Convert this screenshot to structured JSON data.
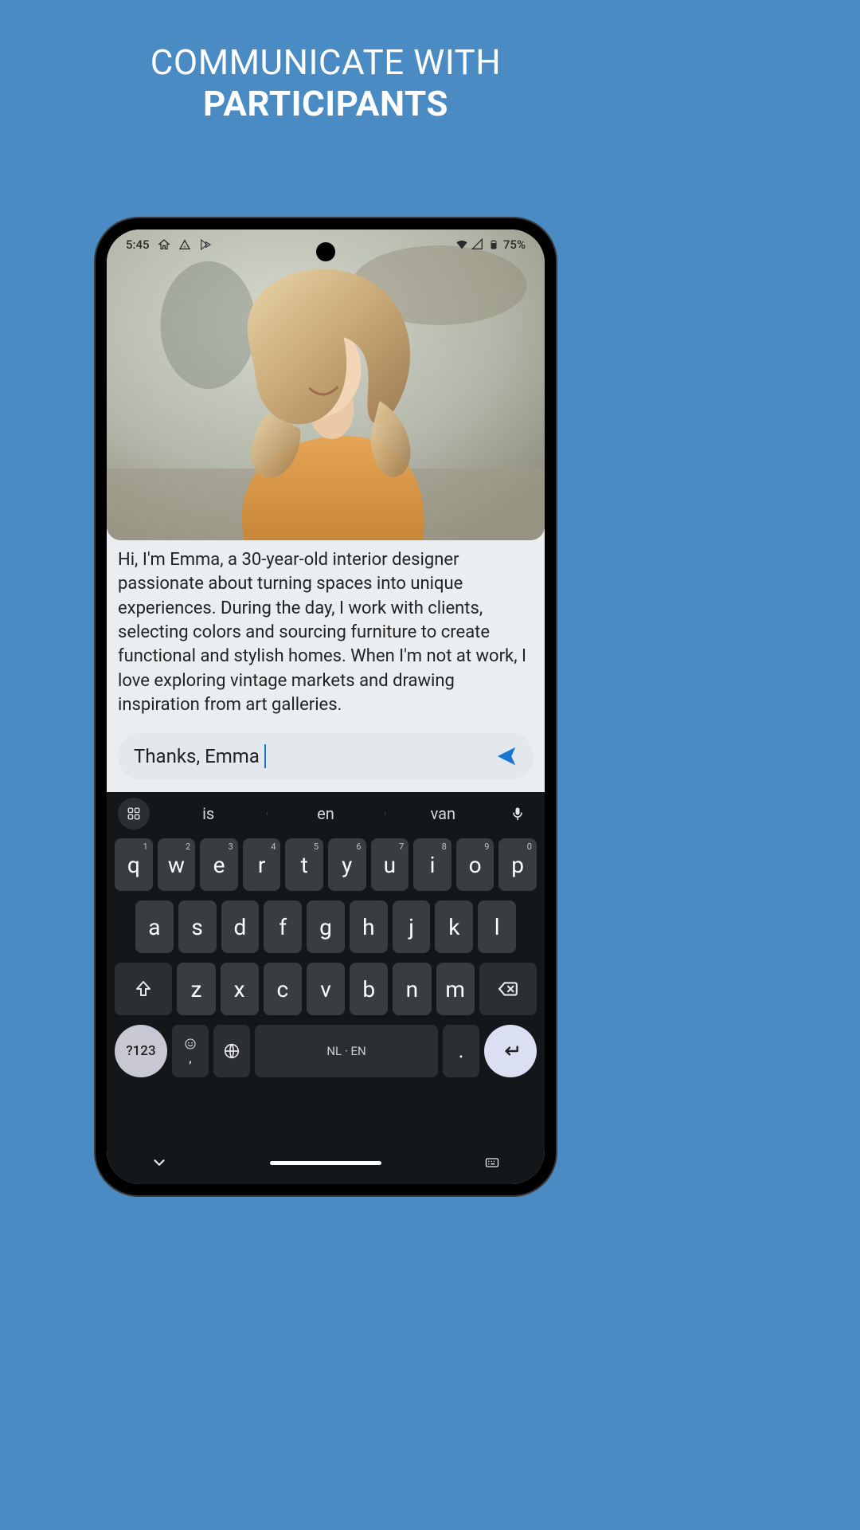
{
  "promo": {
    "line1": "COMMUNICATE WITH",
    "line2": "PARTICIPANTS"
  },
  "status": {
    "time": "5:45",
    "battery": "75%"
  },
  "bio": "Hi, I'm Emma, a 30-year-old interior designer passionate about turning spaces into unique experiences. During the day, I work with clients, selecting colors and sourcing furniture to create functional and stylish homes. When I'm not at work, I love exploring vintage markets and drawing inspiration from art galleries.",
  "input": {
    "value": "Thanks, Emma"
  },
  "keyboard": {
    "suggestions": [
      "is",
      "en",
      "van"
    ],
    "row1": [
      {
        "k": "q",
        "n": "1"
      },
      {
        "k": "w",
        "n": "2"
      },
      {
        "k": "e",
        "n": "3"
      },
      {
        "k": "r",
        "n": "4"
      },
      {
        "k": "t",
        "n": "5"
      },
      {
        "k": "y",
        "n": "6"
      },
      {
        "k": "u",
        "n": "7"
      },
      {
        "k": "i",
        "n": "8"
      },
      {
        "k": "o",
        "n": "9"
      },
      {
        "k": "p",
        "n": "0"
      }
    ],
    "row2": [
      "a",
      "s",
      "d",
      "f",
      "g",
      "h",
      "j",
      "k",
      "l"
    ],
    "row3": [
      "z",
      "x",
      "c",
      "v",
      "b",
      "n",
      "m"
    ],
    "symKey": "?123",
    "spaceLabel": "NL · EN",
    "period": "."
  }
}
